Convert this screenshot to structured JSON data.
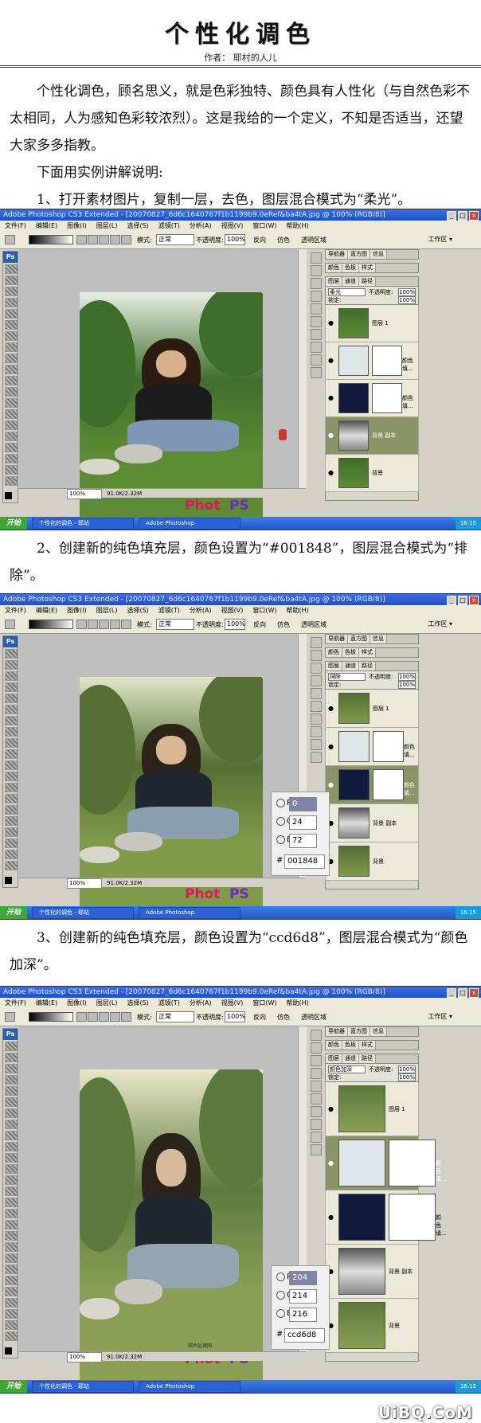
{
  "header": {
    "title": "个性化调色",
    "author": "作者：  耶村的人儿"
  },
  "intro": {
    "paragraph": "个性化调色，顾名思义，就是色彩独特、颜色具有人性化（与自然色彩不太相同，人为感知色彩较浓烈）。这是我给的一个定义，不知是否适当，还望大家多多指教。",
    "lead": "下面用实例讲解说明:",
    "step1": "1、打开素材图片，复制一层，去色，图层混合模式为“柔光”。"
  },
  "step2": "2、创建新的纯色填充层，颜色设置为“#001848”，图层混合模式为“排除”。",
  "step3": "3、创建新的纯色填充层，颜色设置为“ccd6d8”，图层混合模式为“颜色加深”。",
  "ps": {
    "title": "Adobe Photoshop CS3 Extended - [20070827_6d6c1640767f1b1199b9.0eRef&ba4tA.jpg @ 100% (RGB/8)]",
    "menus": [
      "文件(F)",
      "编辑(E)",
      "图像(I)",
      "图层(L)",
      "选择(S)",
      "滤镜(T)",
      "分析(A)",
      "视图(V)",
      "窗口(W)",
      "帮助(H)"
    ],
    "options": {
      "mode_label": "模式:",
      "mode": "正常",
      "opacity_label": "不透明度:",
      "opacity": "100%",
      "reverse": "反向",
      "dither": "仿色",
      "transparency": "透明区域"
    },
    "workspace": "工作区 ▾",
    "tabs_top": [
      "导航器",
      "直方图",
      "信息"
    ],
    "tabs_mid": [
      "颜色",
      "色板",
      "样式"
    ],
    "tabs_layers": [
      "图层",
      "通道",
      "路径"
    ],
    "lock_label": "锁定:",
    "opacity_label": "不透明度:",
    "opacity": "100%",
    "fill_label": "填充:",
    "fill": "100%",
    "zoom": "100%",
    "size": "91.0K/2.32M",
    "start": "开始",
    "taskbar_item1": "个性化的调色 - 耶站",
    "taskbar_item2": "Adobe Photoshop",
    "clock": "16:15",
    "watermark_small": "照片处理网",
    "watermark_main_1": "Phot",
    "watermark_main_2": "PS"
  },
  "screens": [
    {
      "blend_mode": "柔光",
      "layers": [
        {
          "name": "图层 1",
          "thumb": "photo"
        },
        {
          "name": "颜色填...",
          "thumb": "white"
        },
        {
          "name": "颜色填...",
          "thumb": "navy"
        },
        {
          "name": "背景 副本",
          "thumb": "gray",
          "active": true
        },
        {
          "name": "背景",
          "thumb": "photo"
        }
      ]
    },
    {
      "blend_mode": "排除",
      "layers": [
        {
          "name": "图层 1",
          "thumb": "photo"
        },
        {
          "name": "颜色填...",
          "thumb": "white"
        },
        {
          "name": "颜色填...",
          "thumb": "navy",
          "active": true
        },
        {
          "name": "背景 副本",
          "thumb": "gray"
        },
        {
          "name": "背景",
          "thumb": "photo"
        }
      ],
      "color": {
        "r": "0",
        "g": "24",
        "b": "72",
        "hex": "001848"
      }
    },
    {
      "blend_mode": "颜色加深",
      "layers": [
        {
          "name": "图层 1",
          "thumb": "photo"
        },
        {
          "name": "颜色填...",
          "thumb": "white",
          "active": true
        },
        {
          "name": "颜色填...",
          "thumb": "navy"
        },
        {
          "name": "背景 副本",
          "thumb": "gray"
        },
        {
          "name": "背景",
          "thumb": "photo"
        }
      ],
      "color": {
        "r": "204",
        "g": "214",
        "b": "216",
        "hex": "ccd6d8"
      }
    }
  ],
  "color_labels": {
    "r": "R:",
    "g": "G:",
    "b": "B:",
    "hash": "#"
  },
  "site_watermark": "UiBQ.CoM",
  "colors": {
    "accent_navy": "#001848",
    "fill_light": "#ccd6d8",
    "active_layer": "#8b9467"
  }
}
